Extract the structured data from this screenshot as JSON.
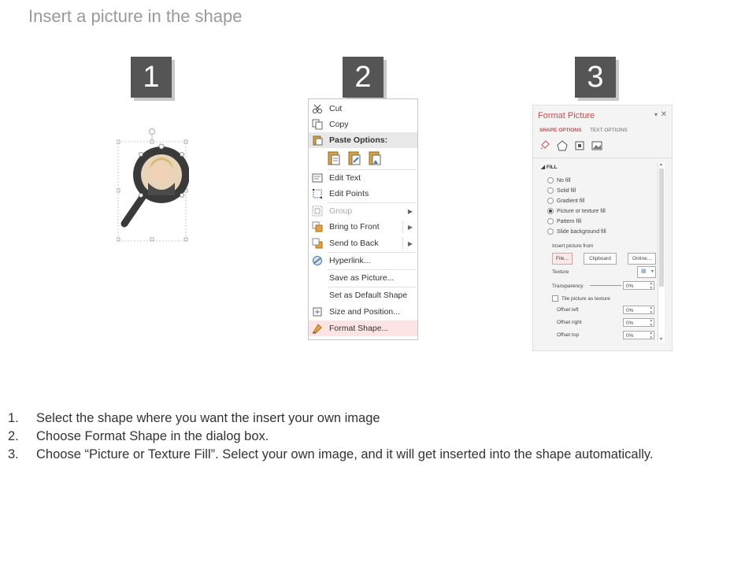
{
  "page": {
    "title": "Insert a picture in the shape"
  },
  "steps": [
    {
      "number": "1"
    },
    {
      "number": "2"
    },
    {
      "number": "3"
    }
  ],
  "context_menu": {
    "items": [
      {
        "label": "Cut",
        "icon": "scissors-icon",
        "disabled": false,
        "submenu": false
      },
      {
        "label": "Copy",
        "icon": "copy-icon",
        "disabled": false,
        "submenu": false
      },
      {
        "label": "Paste Options:",
        "icon": "paste-icon",
        "disabled": false,
        "submenu": false
      },
      {
        "label": "Edit Text",
        "icon": "edit-text-icon",
        "disabled": false,
        "submenu": false
      },
      {
        "label": "Edit Points",
        "icon": "edit-points-icon",
        "disabled": false,
        "submenu": false
      },
      {
        "label": "Group",
        "icon": "group-icon",
        "disabled": true,
        "submenu": true
      },
      {
        "label": "Bring to Front",
        "icon": "bring-front-icon",
        "disabled": false,
        "submenu": true
      },
      {
        "label": "Send to Back",
        "icon": "send-back-icon",
        "disabled": false,
        "submenu": true
      },
      {
        "label": "Hyperlink...",
        "icon": "hyperlink-icon",
        "disabled": false,
        "submenu": false
      },
      {
        "label": "Save as Picture...",
        "icon": "",
        "disabled": false,
        "submenu": false
      },
      {
        "label": "Set as Default Shape",
        "icon": "",
        "disabled": false,
        "submenu": false
      },
      {
        "label": "Size and Position...",
        "icon": "size-position-icon",
        "disabled": false,
        "submenu": false
      },
      {
        "label": "Format Shape...",
        "icon": "format-shape-icon",
        "disabled": false,
        "submenu": false
      }
    ],
    "highlighted": "Format Shape..."
  },
  "format_pane": {
    "title": "Format Picture",
    "tabs": [
      "SHAPE OPTIONS",
      "TEXT OPTIONS"
    ],
    "active_tab": "SHAPE OPTIONS",
    "section": "FILL",
    "fill_options": [
      {
        "label": "No fill",
        "selected": false
      },
      {
        "label": "Solid fill",
        "selected": false
      },
      {
        "label": "Gradient fill",
        "selected": false
      },
      {
        "label": "Picture or texture fill",
        "selected": true
      },
      {
        "label": "Pattern fill",
        "selected": false
      },
      {
        "label": "Slide background fill",
        "selected": false
      }
    ],
    "insert_from_label": "Insert picture from",
    "buttons": [
      "File...",
      "Clipboard",
      "Online..."
    ],
    "texture_label": "Texture",
    "transparency_label": "Transparency",
    "transparency_value": "0%",
    "tile_label": "Tile picture as texture",
    "offsets": [
      {
        "label": "Offset left",
        "value": "0%"
      },
      {
        "label": "Offset right",
        "value": "0%"
      },
      {
        "label": "Offset top",
        "value": "0%"
      }
    ],
    "accent_color": "#c0504d"
  },
  "instructions": [
    {
      "num": "1.",
      "text": "Select the shape where you want the insert your own image"
    },
    {
      "num": "2.",
      "text": "Choose Format Shape in the dialog box."
    },
    {
      "num": "3.",
      "text": "Choose “Picture or Texture Fill”. Select your own image, and it will get inserted into the shape automatically."
    }
  ]
}
